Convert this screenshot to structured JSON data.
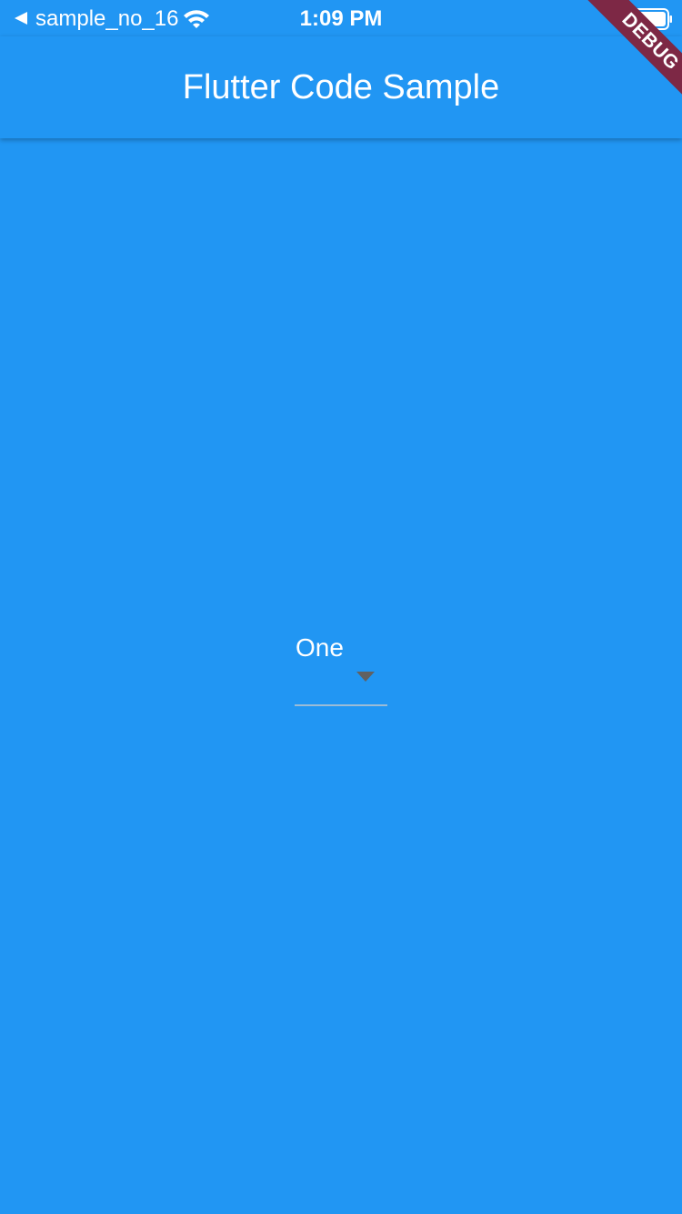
{
  "status_bar": {
    "back_app": "sample_no_16",
    "time": "1:09 PM"
  },
  "debug_banner": {
    "label": "DEBUG",
    "color": "#7d2845"
  },
  "app_bar": {
    "title": "Flutter Code Sample",
    "color": "#2196F3"
  },
  "dropdown": {
    "selected": "One",
    "icon": "arrow-drop-down-icon"
  },
  "icons": [
    "back-arrow-icon",
    "wifi-icon",
    "battery-icon",
    "arrow-drop-down-icon"
  ]
}
